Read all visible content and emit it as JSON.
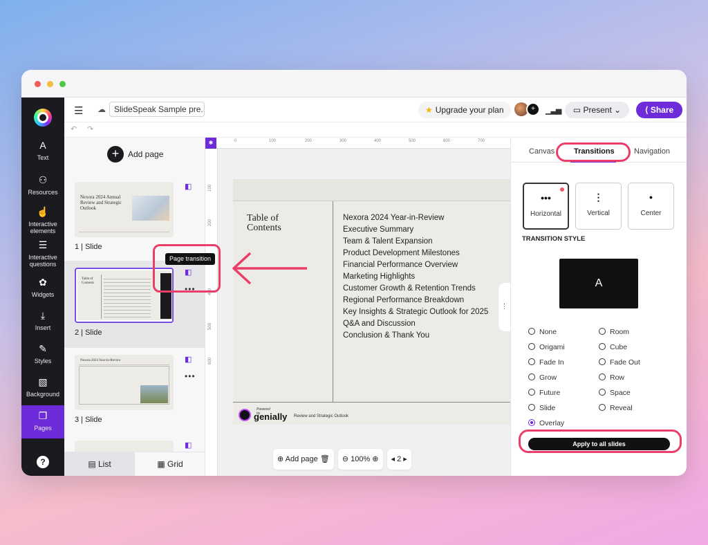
{
  "topbar": {
    "doc_name": "SlideSpeak Sample pre...",
    "upgrade_label": "Upgrade your plan",
    "present_label": "Present",
    "share_label": "Share"
  },
  "leftbar": {
    "items": [
      {
        "label": "Text",
        "icon": "text-icon",
        "glyph": "A"
      },
      {
        "label": "Resources",
        "icon": "shapes-icon",
        "glyph": "⚇"
      },
      {
        "label": "Interactive elements",
        "icon": "touch-icon",
        "glyph": "☝"
      },
      {
        "label": "Interactive questions",
        "icon": "checklist-icon",
        "glyph": "☰"
      },
      {
        "label": "Widgets",
        "icon": "puzzle-icon",
        "glyph": "✿"
      },
      {
        "label": "Insert",
        "icon": "insert-icon",
        "glyph": "⤓"
      },
      {
        "label": "Styles",
        "icon": "brush-icon",
        "glyph": "✎"
      },
      {
        "label": "Background",
        "icon": "pattern-icon",
        "glyph": "▧"
      },
      {
        "label": "Pages",
        "icon": "pages-icon",
        "glyph": "❐"
      }
    ],
    "help_glyph": "?"
  },
  "pages": {
    "add_page_label": "Add page",
    "list": [
      {
        "label": "1 |  Slide",
        "thumb_title": "Nexora 2024 Annual Review and Strategic Outlook"
      },
      {
        "label": "2 |  Slide",
        "thumb_title": "Table of Contents"
      },
      {
        "label": "3 |  Slide",
        "thumb_title": "Nexora 2024 Year-in-Review"
      }
    ],
    "tooltip": "Page transition",
    "view_list": "List",
    "view_grid": "Grid"
  },
  "canvas": {
    "ruler_top": [
      "0",
      "100",
      "200",
      "300",
      "400",
      "500",
      "600",
      "700"
    ],
    "ruler_left": [
      "100",
      "200",
      "300",
      "400",
      "500",
      "600"
    ],
    "slide": {
      "title": "Table of Contents",
      "items": [
        "Nexora 2024 Year-in-Review",
        "Executive Summary",
        "Team & Talent Expansion",
        "Product Development Milestones",
        "Financial Performance Overview",
        "Marketing Highlights",
        "Customer Growth & Retention Trends",
        "Regional Performance Breakdown",
        "Key Insights & Strategic Outlook for 2025",
        "Q&A and Discussion",
        "Conclusion & Thank You"
      ],
      "powered_by": "Powered by",
      "brand": "genially",
      "footer_text": "Review and Strategic Outlook"
    },
    "bottom": {
      "add_page": "Add page",
      "zoom": "100%",
      "page_number": "2"
    }
  },
  "right_panel": {
    "tabs": [
      "Canvas",
      "Transitions",
      "Navigation"
    ],
    "direction_cards": [
      {
        "label": "Horizontal",
        "glyph": "•••"
      },
      {
        "label": "Vertical",
        "glyph": "⋮"
      },
      {
        "label": "Center",
        "glyph": "•"
      }
    ],
    "style_heading": "TRANSITION STYLE",
    "preview_letter": "A",
    "styles_left": [
      "None",
      "Origami",
      "Fade In",
      "Grow",
      "Future",
      "Slide",
      "Overlay"
    ],
    "styles_right": [
      "Room",
      "Cube",
      "Fade Out",
      "Row",
      "Space",
      "Reveal"
    ],
    "selected_style": "Overlay",
    "apply_label": "Apply to all slides"
  },
  "colors": {
    "accent": "#6d2bd9",
    "highlight": "#ea3e68"
  }
}
